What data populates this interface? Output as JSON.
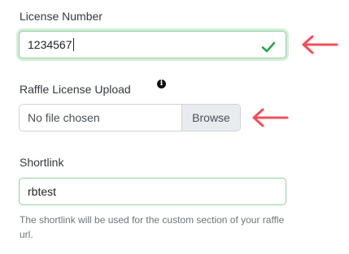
{
  "license": {
    "label": "License Number",
    "value": "1234567",
    "status_icon": "checkmark-icon"
  },
  "upload": {
    "label": "Raffle License Upload",
    "info_icon": "info-icon",
    "info_glyph": "i",
    "file_status": "No file chosen",
    "browse_label": "Browse"
  },
  "shortlink": {
    "label": "Shortlink",
    "value": "rbtest",
    "help": "The shortlink will be used for the custom section of your raffle url."
  },
  "annotations": {
    "arrow_icon": "left-arrow-icon",
    "arrow_color": "#f0505a"
  },
  "colors": {
    "valid_border": "#8fd19e",
    "valid_glow": "#d4edda",
    "check": "#28a745",
    "neutral_border": "#ced4da",
    "button_bg": "#e9ecef",
    "help_text": "#6c757d"
  }
}
